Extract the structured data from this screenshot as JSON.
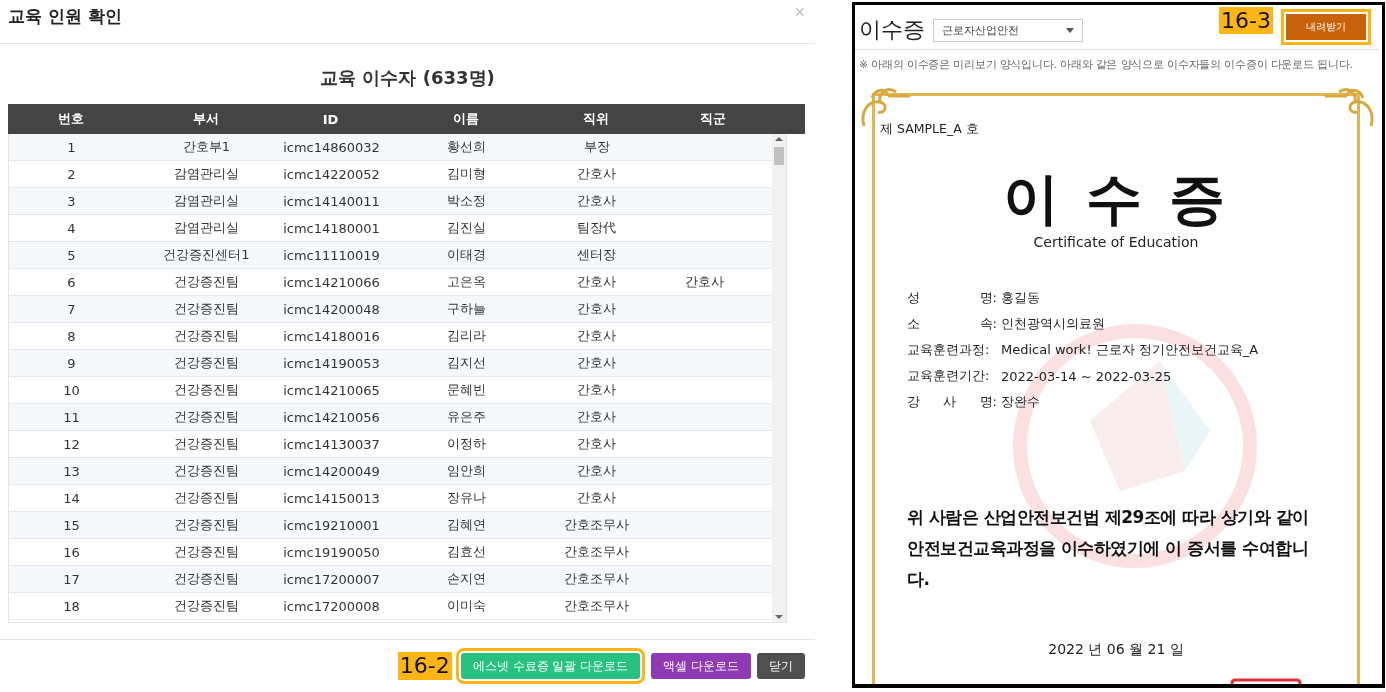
{
  "dialog": {
    "title": "교육 인원 확인",
    "close": "×",
    "heading": "교육 이수자 (633명)",
    "columns": [
      "번호",
      "부서",
      "ID",
      "이름",
      "직위",
      "직군"
    ],
    "rows": [
      {
        "no": "1",
        "dept": "간호부1",
        "id": "icmc14860032",
        "name": "황선희",
        "position": "부장"
      },
      {
        "no": "2",
        "dept": "감염관리실",
        "id": "icmc14220052",
        "name": "김미형",
        "position": "간호사"
      },
      {
        "no": "3",
        "dept": "감염관리실",
        "id": "icmc14140011",
        "name": "박소정",
        "position": "간호사"
      },
      {
        "no": "4",
        "dept": "감염관리실",
        "id": "icmc14180001",
        "name": "김진실",
        "position": "팀장代"
      },
      {
        "no": "5",
        "dept": "건강증진센터1",
        "id": "icmc11110019",
        "name": "이태경",
        "position": "센터장"
      },
      {
        "no": "6",
        "dept": "건강증진팀",
        "id": "icmc14210066",
        "name": "고은옥",
        "position": "간호사",
        "group": "간호사"
      },
      {
        "no": "7",
        "dept": "건강증진팀",
        "id": "icmc14200048",
        "name": "구하늘",
        "position": "간호사"
      },
      {
        "no": "8",
        "dept": "건강증진팀",
        "id": "icmc14180016",
        "name": "김리라",
        "position": "간호사"
      },
      {
        "no": "9",
        "dept": "건강증진팀",
        "id": "icmc14190053",
        "name": "김지선",
        "position": "간호사"
      },
      {
        "no": "10",
        "dept": "건강증진팀",
        "id": "icmc14210065",
        "name": "문혜빈",
        "position": "간호사"
      },
      {
        "no": "11",
        "dept": "건강증진팀",
        "id": "icmc14210056",
        "name": "유은주",
        "position": "간호사"
      },
      {
        "no": "12",
        "dept": "건강증진팀",
        "id": "icmc14130037",
        "name": "이정하",
        "position": "간호사"
      },
      {
        "no": "13",
        "dept": "건강증진팀",
        "id": "icmc14200049",
        "name": "임안희",
        "position": "간호사"
      },
      {
        "no": "14",
        "dept": "건강증진팀",
        "id": "icmc14150013",
        "name": "장유나",
        "position": "간호사"
      },
      {
        "no": "15",
        "dept": "건강증진팀",
        "id": "icmc19210001",
        "name": "김혜연",
        "position": "간호조무사"
      },
      {
        "no": "16",
        "dept": "건강증진팀",
        "id": "icmc19190050",
        "name": "김효선",
        "position": "간호조무사"
      },
      {
        "no": "17",
        "dept": "건강증진팀",
        "id": "icmc17200007",
        "name": "손지연",
        "position": "간호조무사"
      },
      {
        "no": "18",
        "dept": "건강증진팀",
        "id": "icmc17200008",
        "name": "이미숙",
        "position": "간호조무사"
      }
    ],
    "annotation": "16-2",
    "buttons": [
      {
        "label": "에스넷 수료증 일괄 다운로드",
        "kind": "bulk",
        "highlighted": true
      },
      {
        "label": "액셀 다운로드",
        "kind": "excel",
        "highlighted": false
      },
      {
        "label": "닫기",
        "kind": "close",
        "highlighted": false
      }
    ]
  },
  "certificate_panel": {
    "title": "이수증",
    "select": {
      "value": "근로자산업안전"
    },
    "annotation": "16-3",
    "download_button": {
      "label": "내려받기",
      "highlighted": true
    },
    "notice": "※ 아래의 이수증은 미리보기 양식입니다. 아래와 같은 양식으로 이수자들의 이수증이 다운로드 됩니다.",
    "certificate": {
      "number": "제 SAMPLE_A 호",
      "title": "이 수 증",
      "subtitle": "Certificate of Education",
      "fields": [
        {
          "label": "성 명:",
          "value": "홍길동"
        },
        {
          "label": "소 속:",
          "value": "인천광역시의료원"
        },
        {
          "label": "교육훈련과정:",
          "value": "Medical work! 근로자 정기안전보건교육_A"
        },
        {
          "label": "교육훈련기간:",
          "value": "2022-03-14 ~ 2022-03-25"
        },
        {
          "label": "강 사 명:",
          "value": "장완수"
        }
      ],
      "statement": "위 사람은 산업안전보건법 제29조에 따라 상기와 같이 안전보건교육과정을 이수하였기에 이 증서를 수여합니다.",
      "date": "2022 년 06 월 21 일"
    }
  }
}
